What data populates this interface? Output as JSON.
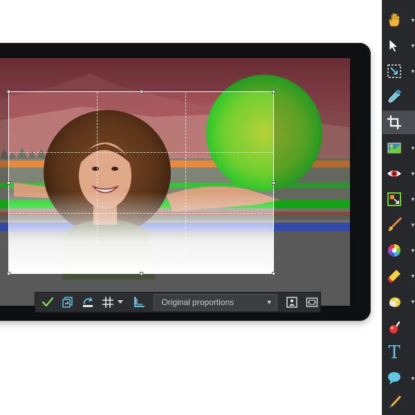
{
  "crop_toolbar": {
    "apply_tooltip": "Apply",
    "proportion_value": "Original proportions"
  },
  "tools": [
    {
      "name": "Hand",
      "icon": "hand-icon",
      "active": false
    },
    {
      "name": "Select",
      "icon": "arrow-select-icon",
      "active": false
    },
    {
      "name": "Resize",
      "icon": "resize-icon",
      "active": false
    },
    {
      "name": "Eyedropper",
      "icon": "eyedropper-icon",
      "active": false
    },
    {
      "name": "Crop",
      "icon": "crop-icon",
      "active": true
    },
    {
      "name": "Straighten",
      "icon": "straighten-icon",
      "active": false
    },
    {
      "name": "Red Eye",
      "icon": "eye-icon",
      "active": false
    },
    {
      "name": "Content-Aware",
      "icon": "content-aware-icon",
      "active": false
    },
    {
      "name": "Brush",
      "icon": "brush-icon",
      "active": false
    },
    {
      "name": "Color",
      "icon": "color-wheel-icon",
      "active": false
    },
    {
      "name": "Eraser",
      "icon": "eraser-icon",
      "active": false
    },
    {
      "name": "Fill",
      "icon": "fill-icon",
      "active": false
    },
    {
      "name": "Pin",
      "icon": "pin-icon",
      "active": false
    },
    {
      "name": "Text",
      "icon": "text-icon",
      "glyph": "T",
      "active": false
    },
    {
      "name": "Speech Bubble",
      "icon": "speech-bubble-icon",
      "active": false
    },
    {
      "name": "Pen",
      "icon": "pen-icon",
      "active": false
    }
  ],
  "colors": {
    "accent_green": "#7ed957",
    "accent_cyan": "#5ec8e5",
    "palette_bg": "#26282b",
    "toolbar_bg": "#2b2d30"
  }
}
